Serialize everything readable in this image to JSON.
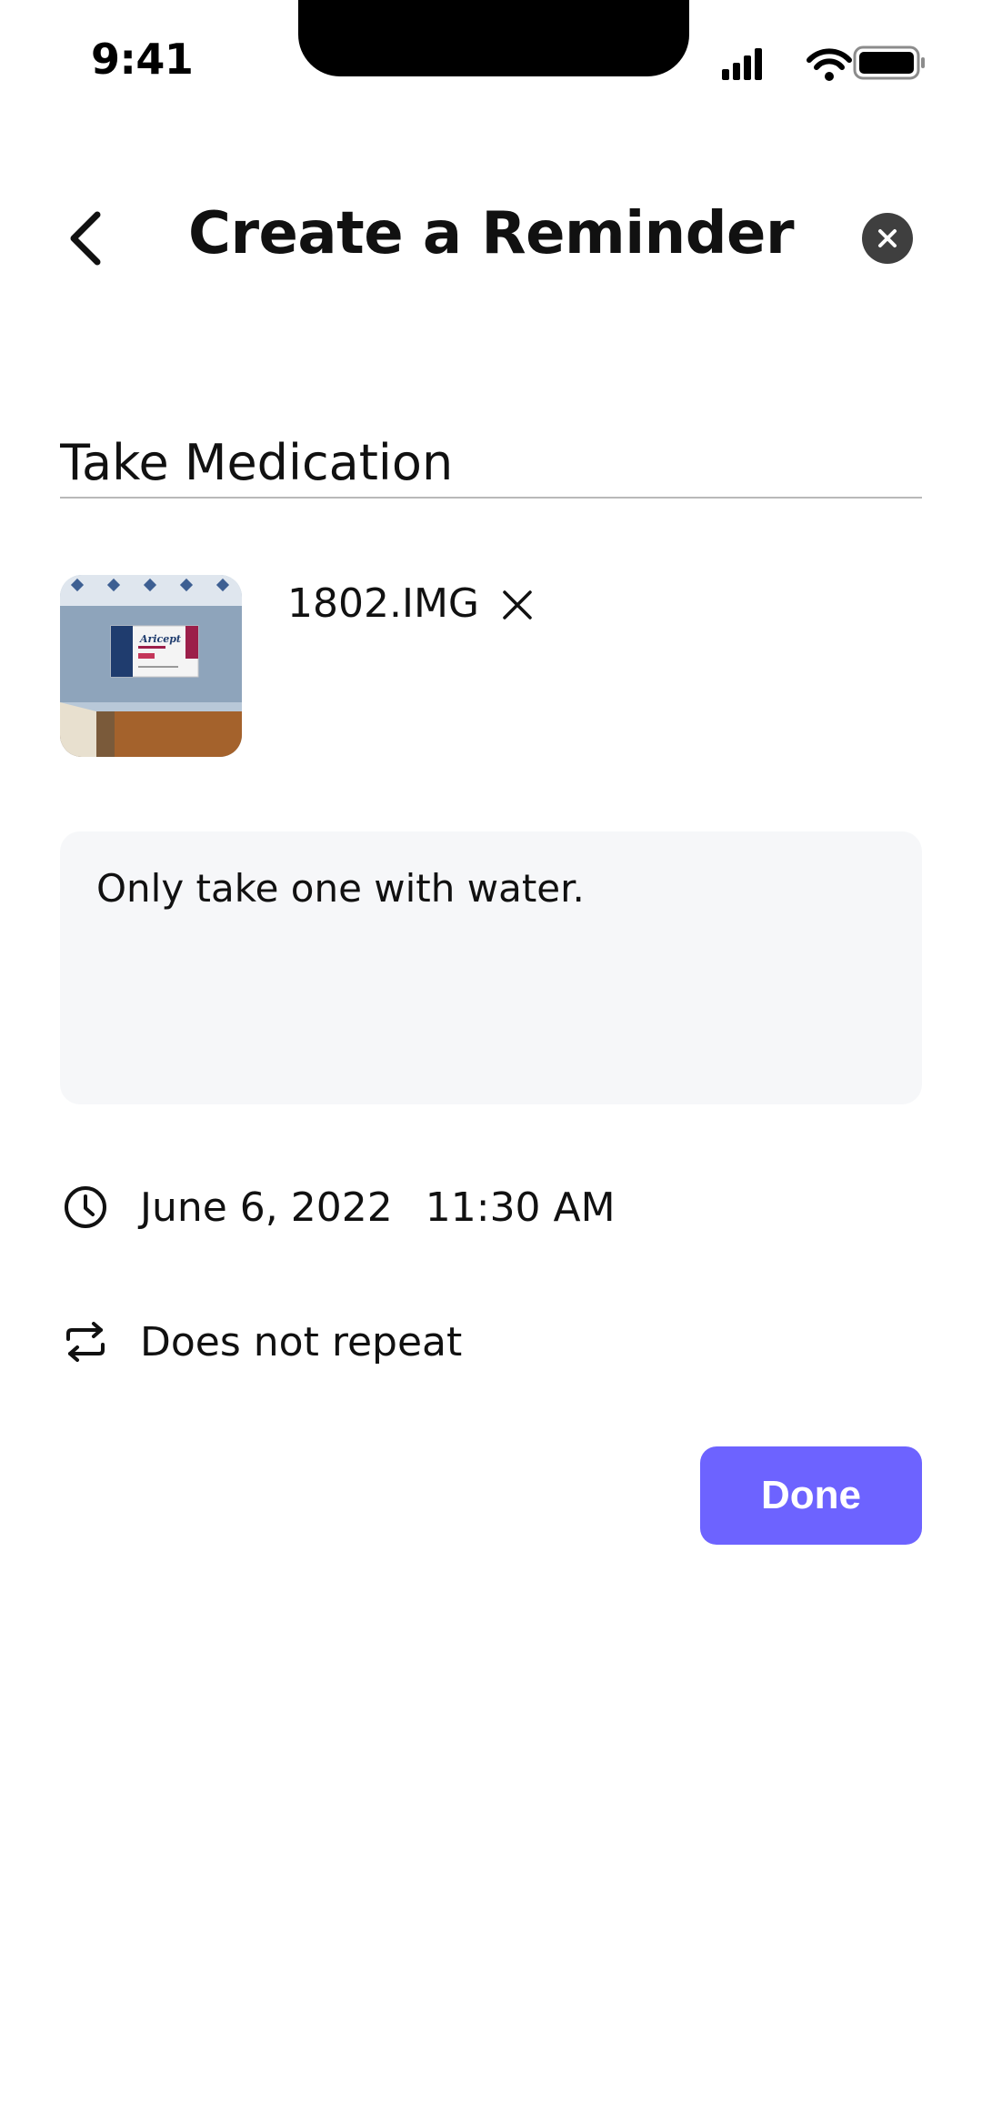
{
  "status_bar": {
    "time": "9:41"
  },
  "header": {
    "title": "Create a Reminder",
    "back_icon": "chevron-left-icon",
    "close_icon": "close-circle-icon"
  },
  "reminder": {
    "title_value": "Take Medication",
    "attachment": {
      "file_name": "1802.IMG",
      "remove_icon": "close-icon",
      "thumbnail_text": "Aricept"
    },
    "notes_value": "Only take one with water.",
    "date": "June 6, 2022",
    "time": "11:30 AM",
    "repeat": "Does not repeat"
  },
  "actions": {
    "done_label": "Done"
  },
  "colors": {
    "accent": "#6d63ff",
    "notes_background": "#f6f7f9",
    "close_button": "#3f3f3f"
  }
}
